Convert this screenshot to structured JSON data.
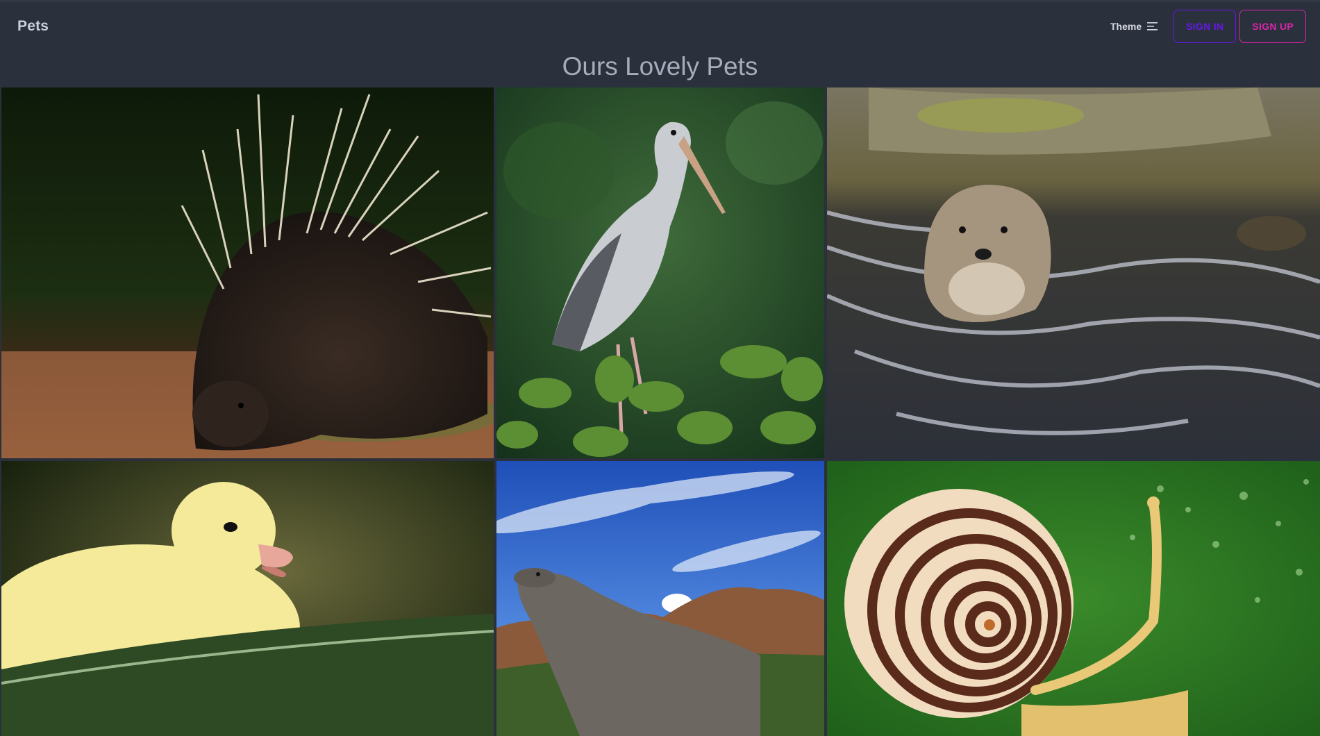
{
  "navbar": {
    "brand": "Pets",
    "theme_label": "Theme",
    "signin_label": "SIGN IN",
    "signup_label": "SIGN UP"
  },
  "heading": "Ours Lovely Pets",
  "colors": {
    "background": "#2a303c",
    "primary": "#661ae6",
    "secondary": "#d926aa",
    "text": "#a6adbb"
  },
  "gallery": [
    {
      "animal": "porcupine"
    },
    {
      "animal": "stork"
    },
    {
      "animal": "otter"
    },
    {
      "animal": "duckling"
    },
    {
      "animal": "komodo-dragon"
    },
    {
      "animal": "snail"
    }
  ]
}
